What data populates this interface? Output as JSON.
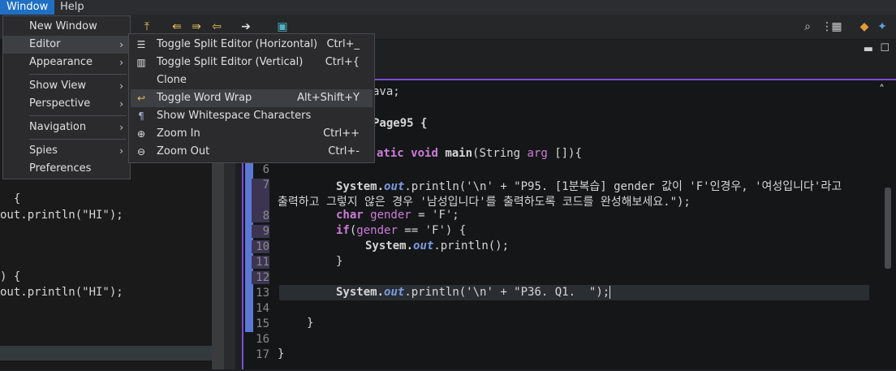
{
  "menubar": {
    "items": [
      "Window",
      "Help"
    ]
  },
  "window_menu": {
    "items": [
      {
        "label": "New Window",
        "submenu": false
      },
      {
        "label": "Editor",
        "submenu": true
      },
      {
        "label": "Appearance",
        "submenu": true
      },
      {
        "label": "Show View",
        "submenu": true
      },
      {
        "label": "Perspective",
        "submenu": true
      },
      {
        "label": "Navigation",
        "submenu": true
      },
      {
        "label": "Spies",
        "submenu": true
      },
      {
        "label": "Preferences",
        "submenu": false
      }
    ],
    "arrow": "›"
  },
  "editor_menu": {
    "items": [
      {
        "label": "Toggle Split Editor (Horizontal)",
        "shortcut": "Ctrl+_",
        "icon": "split-horizontal-icon"
      },
      {
        "label": "Toggle Split Editor (Vertical)",
        "shortcut": "Ctrl+{",
        "icon": "split-vertical-icon"
      },
      {
        "label": "Clone",
        "shortcut": "",
        "icon": ""
      },
      {
        "label": "Toggle Word Wrap",
        "shortcut": "Alt+Shift+Y",
        "icon": "word-wrap-icon"
      },
      {
        "label": "Show Whitespace Characters",
        "shortcut": "",
        "icon": "pilcrow-icon"
      },
      {
        "label": "Zoom In",
        "shortcut": "Ctrl++",
        "icon": "zoom-in-icon"
      },
      {
        "label": "Zoom Out",
        "shortcut": "Ctrl+-",
        "icon": "zoom-out-icon"
      }
    ]
  },
  "left_code": [
    "  {",
    "out.println(\"HI\");",
    ") {",
    "out.println(\"HI\");"
  ],
  "editor": {
    "line_numbers": [
      "6",
      "7",
      "8",
      "9",
      "10",
      "11",
      "12",
      "13",
      "14",
      "15",
      "16",
      "17"
    ],
    "partial_top": [
      "ava;",
      "Page95 {",
      "atic",
      "void",
      "main",
      "(String ",
      "arg",
      " []){"
    ],
    "l7a": "System.",
    "l7b": "out",
    "l7c": ".println('\\n' + \"P95. [1분복습] gender 값이 'F'인경우, '여성입니다'라고",
    "l7wrap": "출력하고 그렇지 않은 경우 '남성입니다'를 출력하도록 코드를 완성해보세요.\");",
    "l8kw": "char",
    "l8var": " gender",
    "l8rest": " = 'F';",
    "l9kw": "if",
    "l9var": "gender",
    "l9open": "(",
    "l9rest": " == 'F') {",
    "l10a": "System.",
    "l10b": "out",
    "l10c": ".println();",
    "l11": "}",
    "l13a": "System.",
    "l13b": "out",
    "l13c": ".println('\\n' + \"P36. Q1.  \");",
    "l15": "}",
    "l17": "}"
  },
  "colors": {
    "accent": "#1f6fc4",
    "editor_border": "#7b4fd4",
    "keyword": "#cc7cd8",
    "field": "#7b9be0"
  }
}
